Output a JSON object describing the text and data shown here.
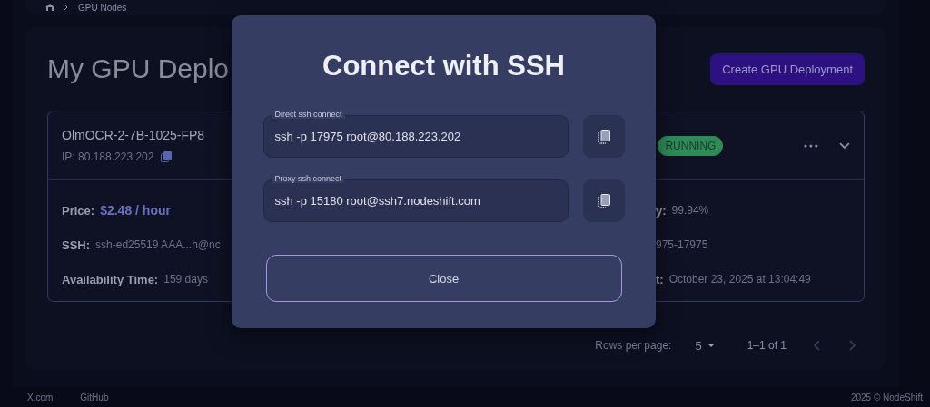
{
  "breadcrumb": {
    "current": "GPU Nodes"
  },
  "page": {
    "title": "My GPU Deplo",
    "create_button": "Create GPU Deployment"
  },
  "deployment": {
    "name": "OlmOCR-2-7B-1025-FP8",
    "ip": "IP: 80.188.223.202",
    "status": "RUNNING",
    "details_left": [
      {
        "label": "Price:",
        "value": "$2.48 / hour",
        "kind": "price"
      },
      {
        "label": "SSH:",
        "value": "ssh-ed25519 AAA...h@nc",
        "kind": "text"
      },
      {
        "label": "Availability Time:",
        "value": "159 days",
        "kind": "text"
      }
    ],
    "details_right": [
      {
        "label": "y:",
        "value": "99.94%",
        "kind": "text"
      },
      {
        "value": "975-17975",
        "kind": "text"
      },
      {
        "label": "t:",
        "value": "October 23, 2025 at 13:04:49",
        "kind": "text"
      }
    ]
  },
  "pagination": {
    "rows_label": "Rows per page:",
    "rows_value": "5",
    "range": "1–1 of 1"
  },
  "modal": {
    "title": "Connect with SSH",
    "fields": [
      {
        "label": "Direct ssh connect",
        "value": "ssh -p 17975 root@80.188.223.202"
      },
      {
        "label": "Proxy ssh connect",
        "value": "ssh -p 15180 root@ssh7.nodeshift.com"
      }
    ],
    "close_button": "Close"
  },
  "footer": {
    "links": [
      "X.com",
      "GitHub"
    ],
    "copyright": "2025 © NodeShift"
  }
}
